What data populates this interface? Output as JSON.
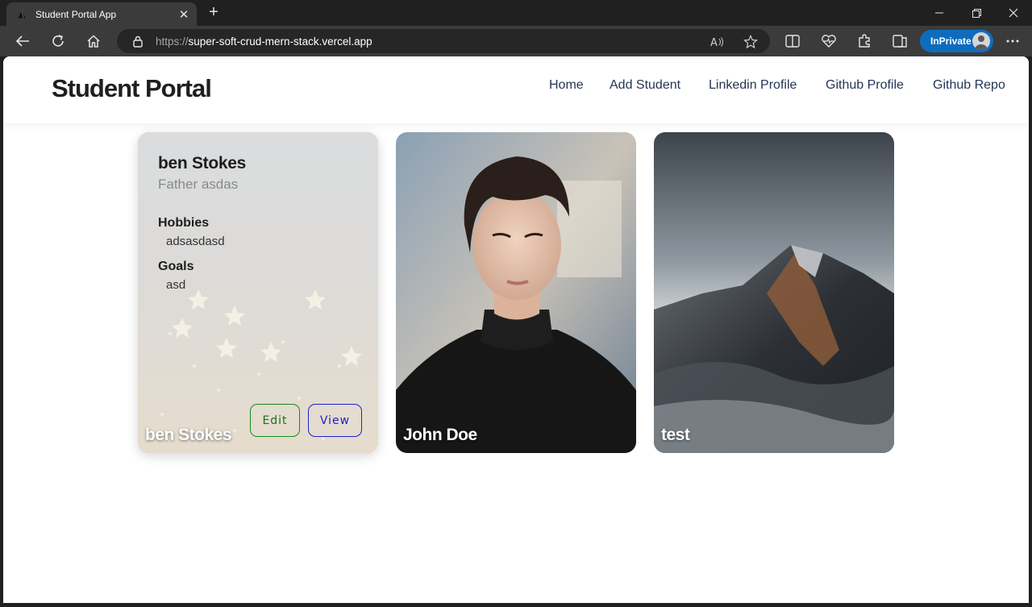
{
  "browser": {
    "tab_title": "Student Portal App",
    "new_tab_symbol": "+",
    "url_scheme": "https://",
    "url_host": "super-soft-crud-mern-stack.vercel.app",
    "inprivate_label": "InPrivate",
    "accent_color": "#0f6cbd"
  },
  "nav": {
    "brand": "Student Portal",
    "links": [
      "Home",
      "Add Student",
      "Linkedin Profile",
      "Github Profile",
      "Github Repo"
    ]
  },
  "students": [
    {
      "name": "ben Stokes",
      "relation": "Father asdas",
      "hobbies_label": "Hobbies",
      "hobbies": "adsasdasd",
      "goals_label": "Goals",
      "goals": "asd",
      "edit_label": "Edit",
      "view_label": "View",
      "image": "golden-stars-lights-photo"
    },
    {
      "name": "John Doe",
      "image": "young-man-portrait-photo"
    },
    {
      "name": "test",
      "image": "snowy-mountain-peak-photo"
    }
  ]
}
